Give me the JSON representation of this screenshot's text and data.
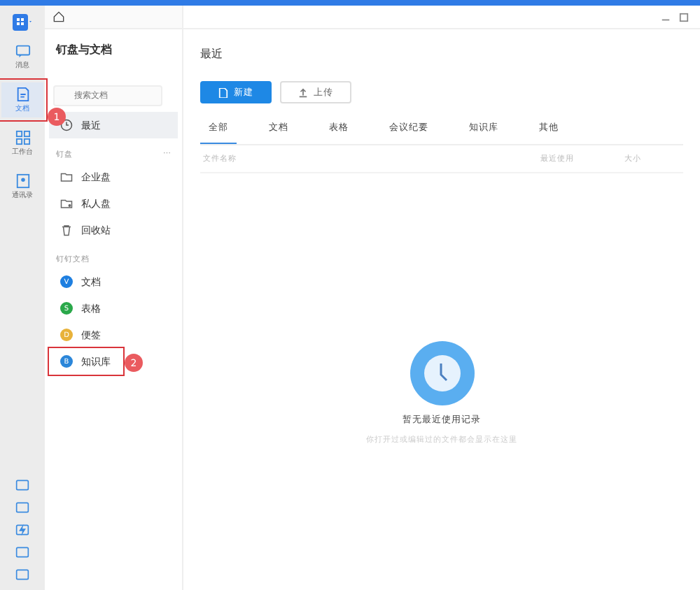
{
  "rail": {
    "items": [
      {
        "label": "消息",
        "selected": false,
        "annotated": false
      },
      {
        "label": "文档",
        "selected": true,
        "annotated": true
      },
      {
        "label": "工作台",
        "selected": false,
        "annotated": false
      },
      {
        "label": "通讯录",
        "selected": false,
        "annotated": false
      }
    ],
    "annotation_badge": "1"
  },
  "panel": {
    "title": "钉盘与文档",
    "search": {
      "placeholder": "搜索文档"
    },
    "recent": {
      "label": "最近",
      "selected": true
    },
    "sections": [
      {
        "title": "钉盘",
        "more": "⋯",
        "items": [
          {
            "label": "企业盘",
            "kind": "location",
            "annotated": false
          },
          {
            "label": "私人盘",
            "kind": "location",
            "annotated": false
          },
          {
            "label": "回收站",
            "kind": "location",
            "annotated": false
          }
        ]
      },
      {
        "title": "钉钉文档",
        "items": [
          {
            "label": "文档",
            "kind": "app",
            "color": "#1e7fe0",
            "letter": "V",
            "annotated": false
          },
          {
            "label": "表格",
            "kind": "app",
            "color": "#2aa84a",
            "letter": "S",
            "annotated": false
          },
          {
            "label": "便签",
            "kind": "app",
            "color": "#e8b23a",
            "letter": "D",
            "annotated": false
          },
          {
            "label": "知识库",
            "kind": "app",
            "color": "#2b86d9",
            "letter": "B",
            "annotated": true
          }
        ]
      }
    ],
    "annotation_badge": "2"
  },
  "main": {
    "title": "最近",
    "buttons": [
      {
        "label": "新建",
        "kind": "primary"
      },
      {
        "label": "上传",
        "kind": "secondary"
      }
    ],
    "tabs": [
      {
        "label": "全部",
        "selected": true
      },
      {
        "label": "文档",
        "selected": false
      },
      {
        "label": "表格",
        "selected": false
      },
      {
        "label": "会议纪要",
        "selected": false
      },
      {
        "label": "知识库",
        "selected": false
      },
      {
        "label": "其他",
        "selected": false
      }
    ],
    "columns": [
      "文件名称",
      "最近使用",
      "大小"
    ],
    "empty": {
      "title": "暂无最近使用记录",
      "hint": "你打开过或编辑过的文件都会显示在这里"
    }
  }
}
